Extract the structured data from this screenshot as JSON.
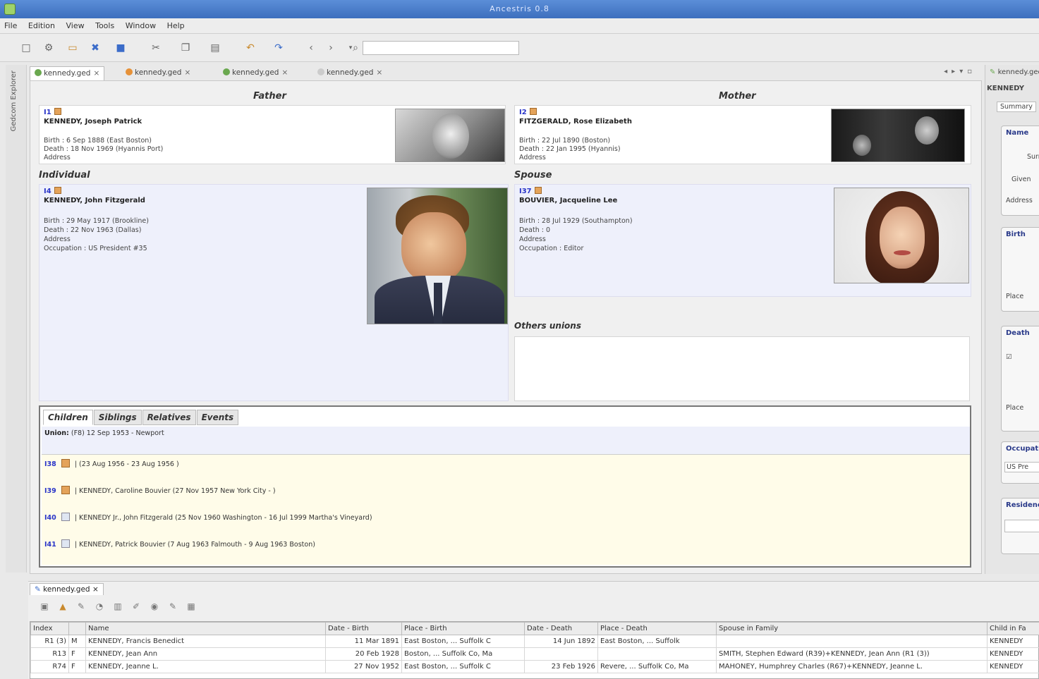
{
  "window": {
    "title": "Ancestris 0.8"
  },
  "menu": [
    "File",
    "Edition",
    "View",
    "Tools",
    "Window",
    "Help"
  ],
  "explorer": {
    "label": "Gedcom Explorer"
  },
  "tabs": [
    {
      "label": "kennedy.ged",
      "active": true,
      "icon_color": "#6aa84f"
    },
    {
      "label": "kennedy.ged",
      "active": false,
      "icon_color": "#e69138"
    },
    {
      "label": "kennedy.ged",
      "active": false,
      "icon_color": "#6aa84f"
    },
    {
      "label": "kennedy.ged",
      "active": false,
      "icon_color": "#cccccc"
    }
  ],
  "family": {
    "father_header": "Father",
    "mother_header": "Mother",
    "individual_header": "Individual",
    "spouse_header": "Spouse",
    "others_header": "Others unions",
    "father": {
      "id": "I1",
      "name": "KENNEDY, Joseph Patrick",
      "birth": "Birth : 6 Sep 1888 (East Boston)",
      "death": "Death : 18 Nov 1969 (Hyannis Port)",
      "address": "Address"
    },
    "mother": {
      "id": "I2",
      "name": "FITZGERALD, Rose Elizabeth",
      "birth": "Birth : 22 Jul 1890 (Boston)",
      "death": "Death : 22 Jan 1995 (Hyannis)",
      "address": "Address"
    },
    "individual": {
      "id": "I4",
      "name": "KENNEDY, John Fitzgerald",
      "birth": "Birth : 29 May 1917 (Brookline)",
      "death": "Death : 22 Nov 1963 (Dallas)",
      "address": "Address",
      "occupation": "Occupation : US President #35"
    },
    "spouse": {
      "id": "I37",
      "name": "BOUVIER, Jacqueline Lee",
      "birth": "Birth : 28 Jul 1929 (Southampton)",
      "death": "Death : 0",
      "address": "Address",
      "occupation": "Occupation : Editor"
    }
  },
  "children_panel": {
    "tabs": [
      "Children",
      "Siblings",
      "Relatives",
      "Events"
    ],
    "union": {
      "label": "Union:",
      "text": "(F8) 12 Sep 1953 - Newport"
    },
    "children": [
      {
        "id": "I38",
        "text": "| (23 Aug 1956 - 23 Aug 1956 )"
      },
      {
        "id": "I39",
        "text": "| KENNEDY, Caroline Bouvier (27 Nov 1957 New York City - )"
      },
      {
        "id": "I40",
        "text": "| KENNEDY Jr., John Fitzgerald (25 Nov 1960 Washington - 16 Jul 1999 Martha's Vineyard)"
      },
      {
        "id": "I41",
        "text": "| KENNEDY, Patrick Bouvier (7 Aug 1963 Falmouth - 9 Aug 1963 Boston)"
      }
    ]
  },
  "right_panel": {
    "tab": "kennedy.ged",
    "title": "KENNEDY",
    "subtab": "Summary",
    "sections": [
      "Name",
      "Birth",
      "Death",
      "Occupation",
      "Residence"
    ],
    "labels": {
      "surname": "Surn",
      "given": "Given",
      "address": "Address",
      "place": "Place",
      "occupation_value": "US Pre"
    }
  },
  "bottom": {
    "tab": "kennedy.ged",
    "columns": [
      "Index",
      "",
      "Name",
      "Date - Birth",
      "Place - Birth",
      "Date - Death",
      "Place - Death",
      "Spouse in Family",
      "Child in Fa"
    ],
    "rows": [
      [
        "R1 (3)",
        "M",
        "KENNEDY, Francis Benedict",
        "11 Mar 1891",
        "East Boston, ... Suffolk C",
        "14 Jun 1892",
        "East Boston, ... Suffolk",
        "",
        "KENNEDY"
      ],
      [
        "R13",
        "F",
        "KENNEDY, Jean Ann",
        "20 Feb 1928",
        "Boston, ... Suffolk Co, Ma",
        "",
        "",
        "SMITH, Stephen Edward (R39)+KENNEDY, Jean Ann (R1 (3))",
        "KENNEDY"
      ],
      [
        "R74",
        "F",
        "KENNEDY, Jeanne L.",
        "27 Nov 1952",
        "East Boston, ... Suffolk C",
        "23 Feb 1926",
        "Revere, ... Suffolk Co, Ma",
        "MAHONEY, Humphrey Charles (R67)+KENNEDY, Jeanne L.",
        "KENNEDY"
      ]
    ]
  }
}
